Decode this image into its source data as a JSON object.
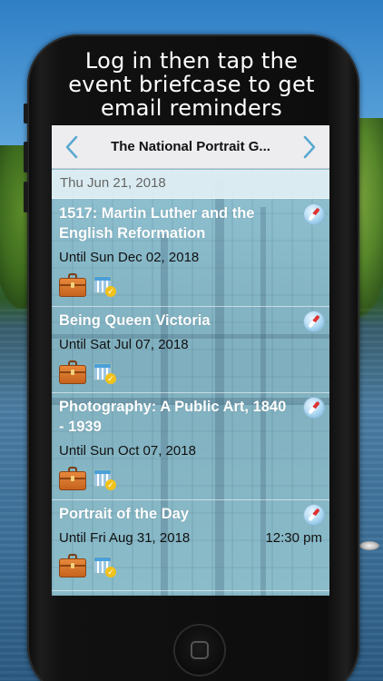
{
  "caption": {
    "line1": "Log in then tap the",
    "line2": "event briefcase to get",
    "line3": "email reminders"
  },
  "navbar": {
    "title": "The National Portrait G...",
    "prev_icon": "chevron-left-icon",
    "next_icon": "chevron-right-icon",
    "accent_color": "#5aa9cf"
  },
  "date_header": "Thu Jun 21, 2018",
  "events": [
    {
      "title": "1517: Martin Luther and the English Reformation",
      "until": "Until Sun Dec 02, 2018",
      "time": ""
    },
    {
      "title": "Being Queen Victoria",
      "until": "Until Sat Jul 07, 2018",
      "time": ""
    },
    {
      "title": "Photography: A Public Art, 1840 - 1939",
      "until": "Until Sun Oct 07, 2018",
      "time": ""
    },
    {
      "title": "Portrait of the Day",
      "until": "Until Fri Aug 31, 2018",
      "time": "12:30 pm"
    }
  ],
  "icons": {
    "briefcase": "briefcase-icon",
    "calendar": "calendar-check-icon",
    "compass": "compass-icon"
  },
  "colors": {
    "screen_tint": "#aee2ec",
    "event_title": "#ffffff",
    "briefcase": "#d8742c"
  }
}
